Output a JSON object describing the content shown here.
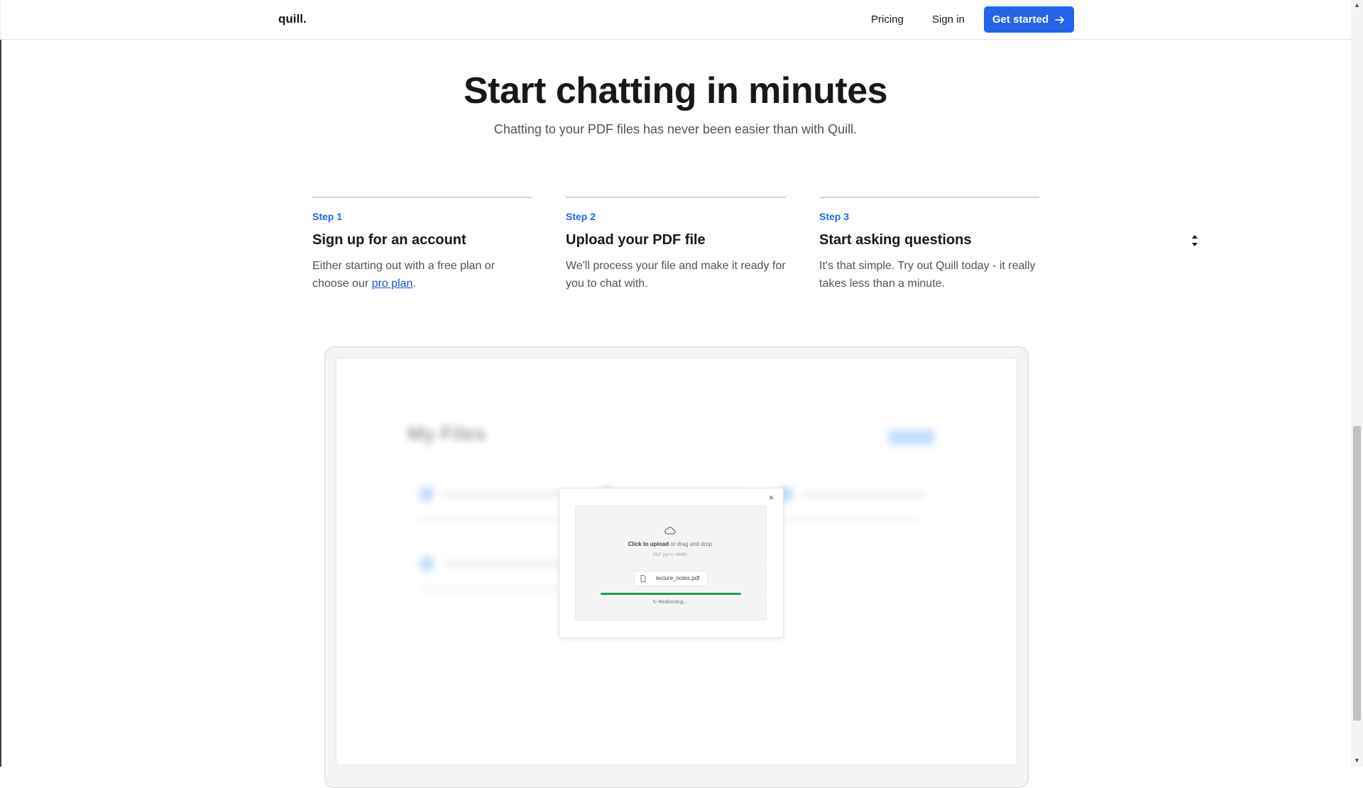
{
  "nav": {
    "logo": "quill.",
    "pricing": "Pricing",
    "sign_in": "Sign in",
    "get_started": "Get started"
  },
  "hero": {
    "title": "Start chatting in minutes",
    "subtitle": "Chatting to your PDF files has never been easier than with Quill."
  },
  "steps": [
    {
      "label": "Step 1",
      "title": "Sign up for an account",
      "desc_before": "Either starting out with a free plan or choose our ",
      "link": "pro plan",
      "desc_after": "."
    },
    {
      "label": "Step 2",
      "title": "Upload your PDF file",
      "desc": "We'll process your file and make it ready for you to chat with."
    },
    {
      "label": "Step 3",
      "title": "Start asking questions",
      "desc": "It's that simple. Try out Quill today - it really takes less than a minute."
    }
  ],
  "preview": {
    "background_title": "My Files",
    "dialog": {
      "close": "×",
      "upload_strong": "Click to upload",
      "upload_rest": " or drag and drop",
      "hint": "PDF (up to 16MB)",
      "file_name": "lecture_notes.pdf",
      "progress": 1.0,
      "status": "Redirecting..."
    }
  },
  "colors": {
    "accent": "#2563eb",
    "progress": "#16a34a"
  }
}
